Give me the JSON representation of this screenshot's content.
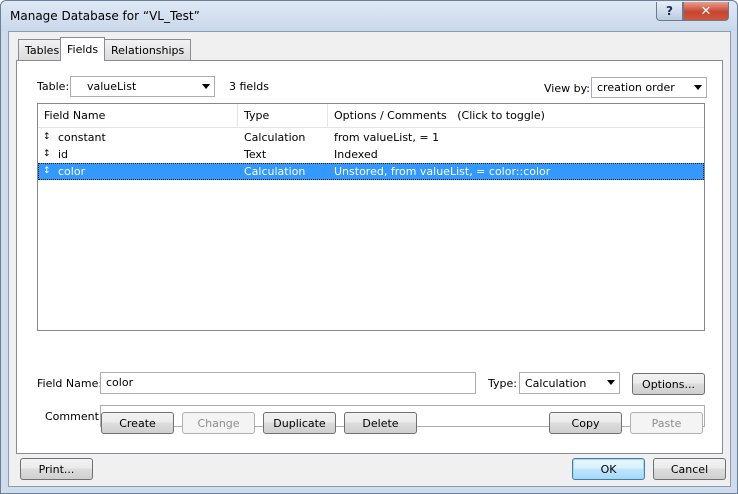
{
  "window": {
    "title": "Manage Database for “VL_Test”",
    "help_label": "?",
    "close_label": "✕"
  },
  "tabs": [
    {
      "label": "Tables",
      "active": false
    },
    {
      "label": "Fields",
      "active": true
    },
    {
      "label": "Relationships",
      "active": false
    }
  ],
  "table_selector": {
    "label": "Table:",
    "value": "valueList",
    "field_count": "3 fields"
  },
  "view_by": {
    "label": "View by:",
    "value": "creation order"
  },
  "fields_list": {
    "columns": [
      "Field Name",
      "Type",
      "Options / Comments   (Click to toggle)"
    ],
    "rows": [
      {
        "name": "constant",
        "type": "Calculation",
        "options": "from valueList, = 1",
        "selected": false
      },
      {
        "name": "id",
        "type": "Text",
        "options": "Indexed",
        "selected": false
      },
      {
        "name": "color",
        "type": "Calculation",
        "options": "Unstored, from valueList, = color::color",
        "selected": true
      }
    ],
    "grip_icon": "↕"
  },
  "field_editor": {
    "name_label": "Field Name:",
    "name_value": "color",
    "type_label": "Type:",
    "type_value": "Calculation",
    "options_label": "Options...",
    "comment_label": "Comment:",
    "comment_value": ""
  },
  "action_buttons": {
    "create": "Create",
    "change": "Change",
    "duplicate": "Duplicate",
    "delete": "Delete",
    "copy": "Copy",
    "paste": "Paste"
  },
  "footer": {
    "print": "Print...",
    "ok": "OK",
    "cancel": "Cancel"
  },
  "colors": {
    "selection": "#3399ff",
    "chrome": "#cfdcec",
    "close_button": "#c6452f"
  }
}
